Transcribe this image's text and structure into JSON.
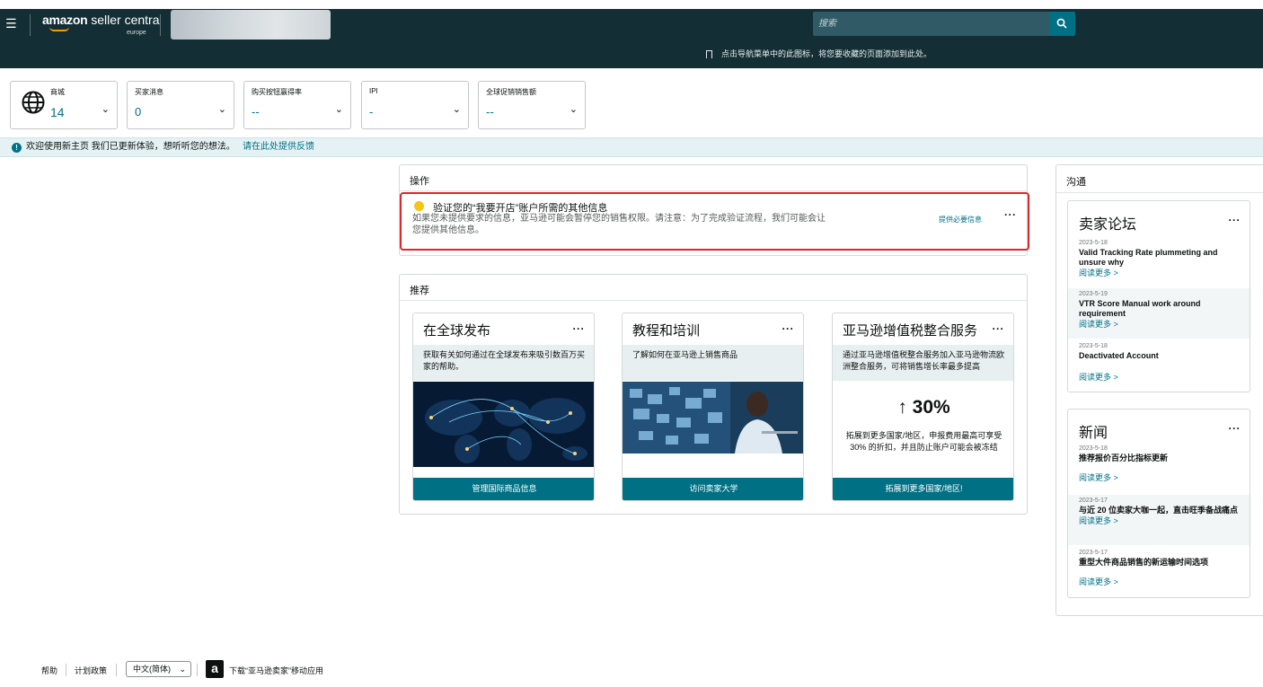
{
  "header": {
    "brand_main": "amazon",
    "brand_sub": "seller centra",
    "region": "europe",
    "search_placeholder": "搜索"
  },
  "subbar": {
    "message": "点击导航菜单中的此图标，将您要收藏的页面添加到此处。"
  },
  "widgets": [
    {
      "label": "商城",
      "value": "14"
    },
    {
      "label": "买家消息",
      "value": "0"
    },
    {
      "label": "购买按钮赢得率",
      "value": "--"
    },
    {
      "label": "IPI",
      "value": "-"
    },
    {
      "label": "全球促销销售额",
      "value": "--"
    }
  ],
  "banner": {
    "message": "欢迎使用新主页 我们已更新体验，想听听您的想法。",
    "link": "请在此处提供反馈"
  },
  "actions": {
    "title": "操作",
    "task_title": "验证您的“我要开店”账户所需的其他信息",
    "task_desc": "如果您未提供要求的信息，亚马逊可能会暂停您的销售权限。请注意：为了完成验证流程，我们可能会让您提供其他信息。",
    "task_action": "提供必要信息"
  },
  "recommend": {
    "title": "推荐",
    "cards": [
      {
        "title": "在全球发布",
        "desc": "获取有关如何通过在全球发布来吸引数百万买家的帮助。",
        "button": "管理国际商品信息"
      },
      {
        "title": "教程和培训",
        "desc": "了解如何在亚马逊上销售商品",
        "button": "访问卖家大学"
      },
      {
        "title": "亚马逊增值税整合服务",
        "desc": "通过亚马逊增值税整合服务加入亚马逊物流欧洲整合服务，可将销售增长率最多提高",
        "big": "↑ 30%",
        "big_desc": "拓展到更多国家/地区，申报费用最高可享受 30% 的折扣，并且防止账户可能会被冻结",
        "button": "拓展到更多国家/地区!"
      }
    ]
  },
  "sidebar": {
    "title": "沟通",
    "forum": {
      "title": "卖家论坛",
      "items": [
        {
          "date": "2023-5-18",
          "headline": "Valid Tracking Rate plummeting and unsure why",
          "more": "阅读更多 >"
        },
        {
          "date": "2023-5-19",
          "headline": "VTR Score Manual work around requirement",
          "more": "阅读更多 >"
        },
        {
          "date": "2023-5-18",
          "headline": "Deactivated Account",
          "more": "阅读更多 >"
        }
      ]
    },
    "news": {
      "title": "新闻",
      "items": [
        {
          "date": "2023-5-18",
          "headline": "推荐报价百分比指标更新",
          "more": "阅读更多 >"
        },
        {
          "date": "2023-5-17",
          "headline": "与近 20 位卖家大咖一起，直击旺季备战痛点",
          "more": "阅读更多 >"
        },
        {
          "date": "2023-5-17",
          "headline": "重型大件商品销售的新运输时间选项",
          "more": "阅读更多 >"
        }
      ]
    }
  },
  "footer": {
    "help": "帮助",
    "policy": "计划政策",
    "language": "中文(简体)",
    "app_download": "下载“亚马逊卖家”移动应用"
  }
}
